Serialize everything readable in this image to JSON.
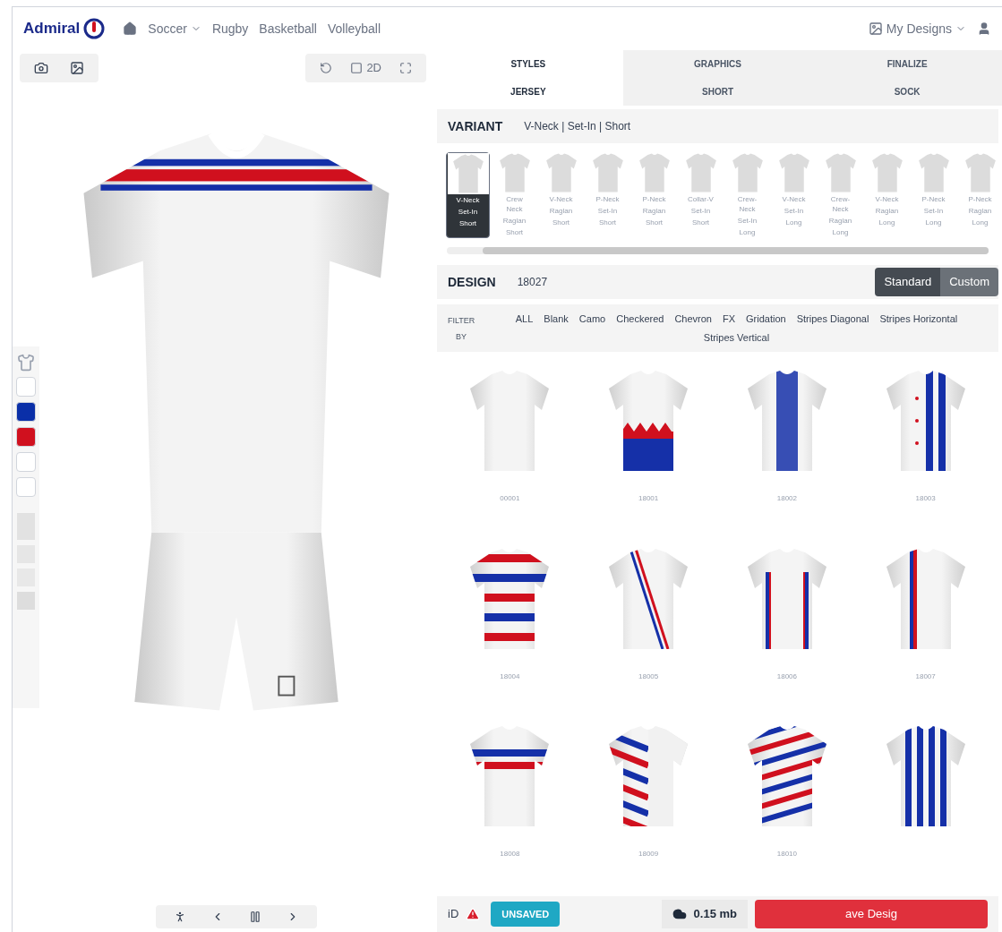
{
  "brand": "Admiral",
  "nav": [
    {
      "label": "Soccer",
      "dropdown": true
    },
    {
      "label": "Rugby",
      "dropdown": false
    },
    {
      "label": "Basketball",
      "dropdown": false
    },
    {
      "label": "Volleyball",
      "dropdown": false
    }
  ],
  "account": {
    "label": "My Designs"
  },
  "viewer": {
    "toggle_2d": {
      "label": "2D",
      "checked": false
    },
    "swatches": [
      {
        "color": "#ffffff",
        "selected": false
      },
      {
        "color": "#0a2fa8",
        "selected": false
      },
      {
        "color": "#d0101e",
        "selected": false
      },
      {
        "color": "#ffffff",
        "selected": false
      },
      {
        "color": "#ffffff",
        "selected": false
      }
    ]
  },
  "tabs": [
    {
      "label": "STYLES",
      "selected": true
    },
    {
      "label": "GRAPHICS",
      "selected": false
    },
    {
      "label": "FINALIZE",
      "selected": false
    }
  ],
  "subtabs": [
    {
      "label": "JERSEY",
      "selected": true
    },
    {
      "label": "SHORT",
      "selected": false
    },
    {
      "label": "SOCK",
      "selected": false
    }
  ],
  "variant": {
    "heading": "VARIANT",
    "value": "V-Neck | Set-In | Short"
  },
  "variants": [
    {
      "lines": [
        "V-Neck",
        "Set-In",
        "Short"
      ],
      "selected": true
    },
    {
      "lines": [
        "Crew Neck",
        "Raglan",
        "Short"
      ],
      "selected": false
    },
    {
      "lines": [
        "V-Neck",
        "Raglan",
        "Short"
      ],
      "selected": false
    },
    {
      "lines": [
        "P-Neck",
        "Set-In",
        "Short"
      ],
      "selected": false
    },
    {
      "lines": [
        "P-Neck",
        "Raglan",
        "Short"
      ],
      "selected": false
    },
    {
      "lines": [
        "Collar-V",
        "Set-In",
        "Short"
      ],
      "selected": false
    },
    {
      "lines": [
        "Crew-Neck",
        "Set-In",
        "Long"
      ],
      "selected": false
    },
    {
      "lines": [
        "V-Neck",
        "Set-In",
        "Long"
      ],
      "selected": false
    },
    {
      "lines": [
        "Crew-Neck",
        "Raglan",
        "Long"
      ],
      "selected": false
    },
    {
      "lines": [
        "V-Neck",
        "Raglan",
        "Long"
      ],
      "selected": false
    },
    {
      "lines": [
        "P-Neck",
        "Set-In",
        "Long"
      ],
      "selected": false
    },
    {
      "lines": [
        "P-Neck",
        "Raglan",
        "Long"
      ],
      "selected": false
    }
  ],
  "design": {
    "heading": "DESIGN",
    "value": "18027",
    "modes": [
      {
        "label": "Standard",
        "selected": true
      },
      {
        "label": "Custom",
        "selected": false
      }
    ]
  },
  "filter": {
    "label": "FILTER BY",
    "options": [
      "ALL",
      "Blank",
      "Camo",
      "Checkered",
      "Chevron",
      "FX",
      "Gridation",
      "Stripes Diagonal",
      "Stripes Horizontal",
      "Stripes Vertical"
    ]
  },
  "designs": [
    {
      "label": "00001",
      "kind": "blank"
    },
    {
      "label": "18001",
      "kind": "diamonds"
    },
    {
      "label": "18002",
      "kind": "center"
    },
    {
      "label": "18003",
      "kind": "stars"
    },
    {
      "label": "18004",
      "kind": "hoops"
    },
    {
      "label": "18005",
      "kind": "sash"
    },
    {
      "label": "18006",
      "kind": "sides"
    },
    {
      "label": "18007",
      "kind": "offset"
    },
    {
      "label": "18008",
      "kind": "chest"
    },
    {
      "label": "18009",
      "kind": "halfdiag"
    },
    {
      "label": "18010",
      "kind": "diagonal"
    },
    {
      "kind": "vertical"
    }
  ],
  "status": {
    "id_label": "iD",
    "badge": "UNSAVED",
    "size": "0.15 mb",
    "save": "ave Desig"
  }
}
